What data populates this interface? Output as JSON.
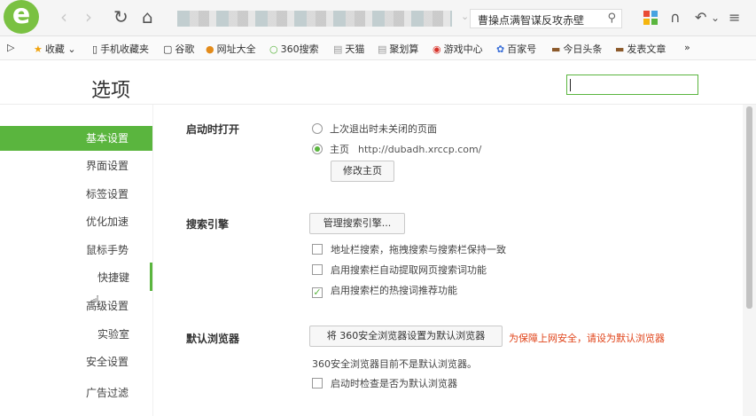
{
  "toolbar": {
    "logo_letter": "e",
    "back_icon": "‹",
    "forward_icon": "›",
    "reload_icon": "↻",
    "home_icon": "⌂",
    "address_separator": "⌄",
    "search_text": "曹操点满智谋反攻赤壁",
    "search_icon": "⚲",
    "headset_icon": "∩",
    "undo_icon": "↶",
    "dropdown_icon": "⌄",
    "menu_icon": "≡"
  },
  "bookmarks": [
    {
      "icon": "▷",
      "label": ""
    },
    {
      "icon": "★",
      "label": "收藏 ⌄"
    },
    {
      "icon": "▯",
      "label": "手机收藏夹"
    },
    {
      "icon": "▢",
      "label": "谷歌"
    },
    {
      "icon": "●",
      "label": "网址大全"
    },
    {
      "icon": "○",
      "label": "360搜索"
    },
    {
      "icon": "▤",
      "label": "天猫"
    },
    {
      "icon": "▤",
      "label": "聚划算"
    },
    {
      "icon": "◉",
      "label": "游戏中心"
    },
    {
      "icon": "✿",
      "label": "百家号"
    },
    {
      "icon": "▬",
      "label": "今日头条"
    },
    {
      "icon": "▬",
      "label": "发表文章"
    },
    {
      "icon": "»",
      "label": ""
    }
  ],
  "page": {
    "title": "选项"
  },
  "sidebar": {
    "items": [
      {
        "label": "基本设置",
        "active": true
      },
      {
        "label": "界面设置"
      },
      {
        "label": "标签设置"
      },
      {
        "label": "优化加速"
      },
      {
        "label": "鼠标手势"
      },
      {
        "label": "快捷键"
      },
      {
        "label": "高级设置"
      },
      {
        "label": "实验室"
      },
      {
        "label": "安全设置"
      },
      {
        "label": "广告过滤"
      }
    ]
  },
  "startup": {
    "label": "启动时打开",
    "option_last": "上次退出时未关闭的页面",
    "option_home": "主页",
    "home_url": "http://dubadh.xrccp.com/",
    "selected": "home",
    "edit_home_button": "修改主页"
  },
  "search_engine": {
    "label": "搜索引擎",
    "manage_button": "管理搜索引擎...",
    "options": [
      {
        "label": "地址栏搜索，拖拽搜索与搜索栏保持一致",
        "checked": false
      },
      {
        "label": "启用搜索栏自动提取网页搜索词功能",
        "checked": false
      },
      {
        "label": "启用搜索栏的热搜词推荐功能",
        "checked": true
      }
    ]
  },
  "default_browser": {
    "label": "默认浏览器",
    "set_default_button": "将 360安全浏览器设置为默认浏览器",
    "warning": "为保障上网安全，请设为默认浏览器",
    "status": "360安全浏览器目前不是默认浏览器。",
    "check_on_start": "启动时检查是否为默认浏览器",
    "check_on_start_checked": false
  },
  "colors": {
    "accent": "#5ab53e",
    "warning": "#e0441a"
  }
}
